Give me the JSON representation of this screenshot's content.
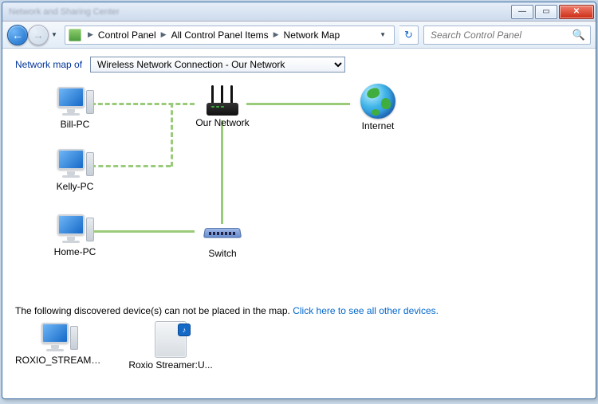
{
  "window": {
    "title": "Network and Sharing Center"
  },
  "breadcrumb": {
    "items": [
      "Control Panel",
      "All Control Panel Items",
      "Network Map"
    ]
  },
  "search": {
    "placeholder": "Search Control Panel"
  },
  "mapof": {
    "label": "Network map of",
    "selected": "Wireless Network Connection - Our Network"
  },
  "nodes": {
    "billpc": "Bill-PC",
    "kellypc": "Kelly-PC",
    "homepc": "Home-PC",
    "router": "Our Network",
    "switch": "Switch",
    "internet": "Internet"
  },
  "footer": {
    "text": "The following discovered device(s) can not be placed in the map.",
    "link": "Click here to see all other devices."
  },
  "unplaced": {
    "roxio_streamer": "ROXIO_STREAMER",
    "roxio_device": "Roxio Streamer:U..."
  }
}
